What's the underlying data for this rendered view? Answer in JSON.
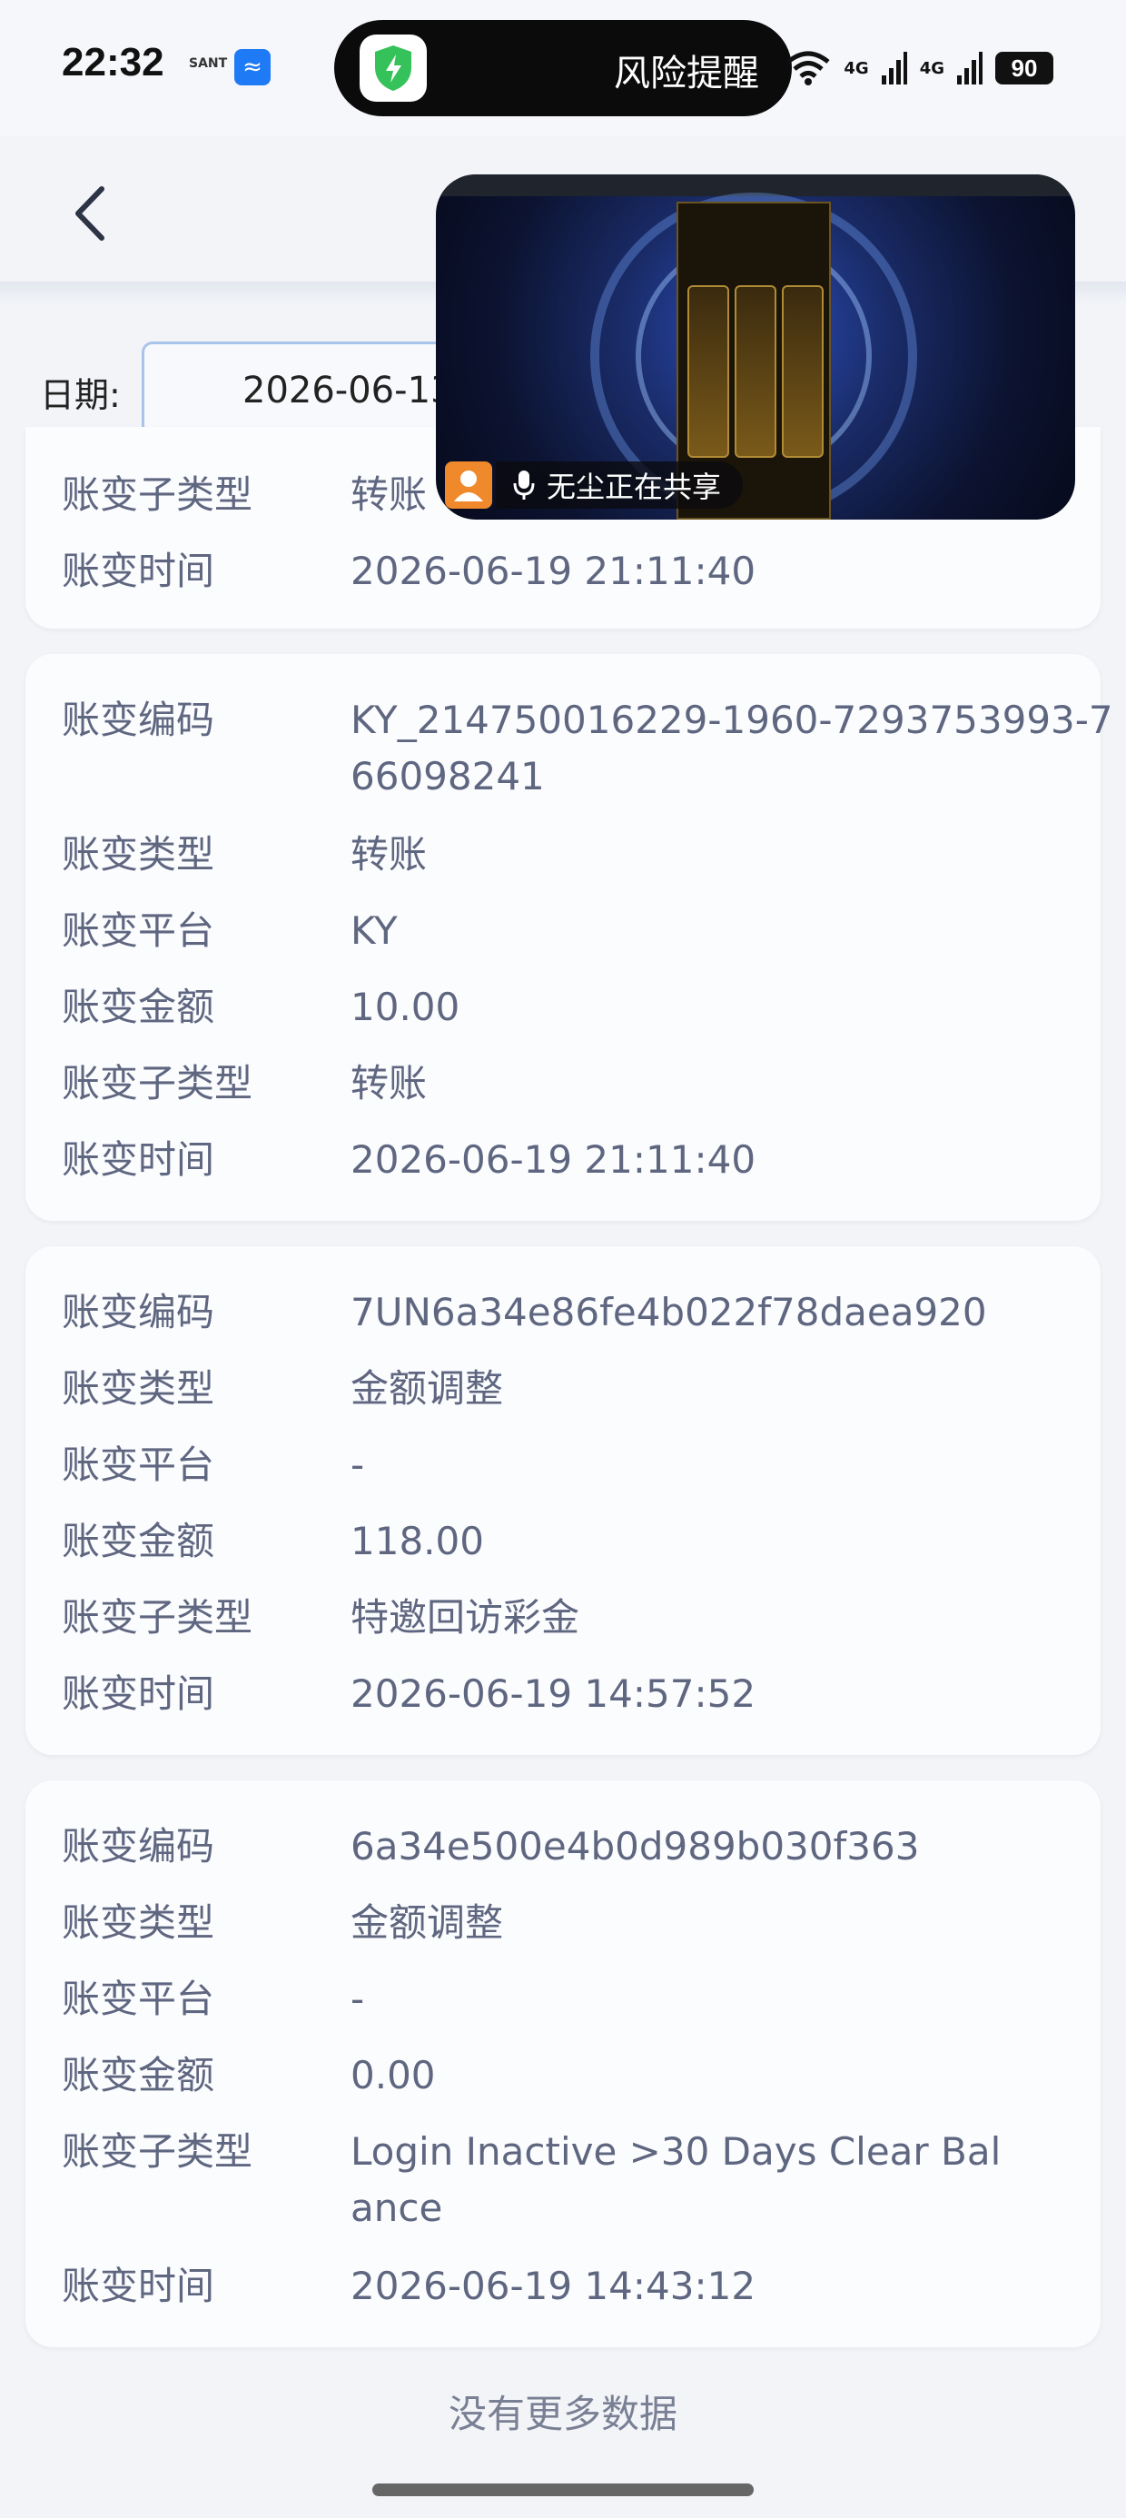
{
  "status_bar": {
    "time": "22:32",
    "sant_label": "SANT",
    "risk_alert": "风险提醒",
    "network_1": "4G",
    "network_2": "4G",
    "battery": "90"
  },
  "filter": {
    "date_label": "日期:",
    "date_value": "2026-06-13"
  },
  "screen_share": {
    "label": "无尘正在共享"
  },
  "partial_card": {
    "rows": [
      {
        "key": "账变子类型",
        "value": "转账"
      },
      {
        "key": "账变时间",
        "value": "2026-06-19 21:11:40"
      }
    ]
  },
  "records": [
    {
      "rows": [
        {
          "key": "账变编码",
          "value": "KY_214750016229-1960-7293753993-766098241"
        },
        {
          "key": "账变类型",
          "value": "转账"
        },
        {
          "key": "账变平台",
          "value": "KY"
        },
        {
          "key": "账变金额",
          "value": "10.00"
        },
        {
          "key": "账变子类型",
          "value": "转账"
        },
        {
          "key": "账变时间",
          "value": "2026-06-19 21:11:40"
        }
      ]
    },
    {
      "rows": [
        {
          "key": "账变编码",
          "value": "7UN6a34e86fe4b022f78daea920"
        },
        {
          "key": "账变类型",
          "value": "金额调整"
        },
        {
          "key": "账变平台",
          "value": "-"
        },
        {
          "key": "账变金额",
          "value": "118.00"
        },
        {
          "key": "账变子类型",
          "value": "特邀回访彩金"
        },
        {
          "key": "账变时间",
          "value": "2026-06-19 14:57:52"
        }
      ]
    },
    {
      "rows": [
        {
          "key": "账变编码",
          "value": "6a34e500e4b0d989b030f363"
        },
        {
          "key": "账变类型",
          "value": "金额调整"
        },
        {
          "key": "账变平台",
          "value": "-"
        },
        {
          "key": "账变金额",
          "value": "0.00"
        },
        {
          "key": "账变子类型",
          "value": "Login Inactive >30 Days Clear Balance"
        },
        {
          "key": "账变时间",
          "value": "2026-06-19 14:43:12"
        }
      ]
    }
  ],
  "footer": {
    "no_more": "没有更多数据"
  },
  "icons": {
    "back": "chevron-left-icon",
    "shield": "shield-bolt-icon",
    "wifi": "wifi-icon",
    "signal": "signal-icon",
    "mic": "mic-icon",
    "person": "person-icon"
  },
  "colors": {
    "page_bg": "#f2f4f8",
    "card_bg": "#fbfcfe",
    "text_gray": "#5f6680",
    "shield_green": "#36c25a",
    "share_badge": "#f0892b"
  }
}
